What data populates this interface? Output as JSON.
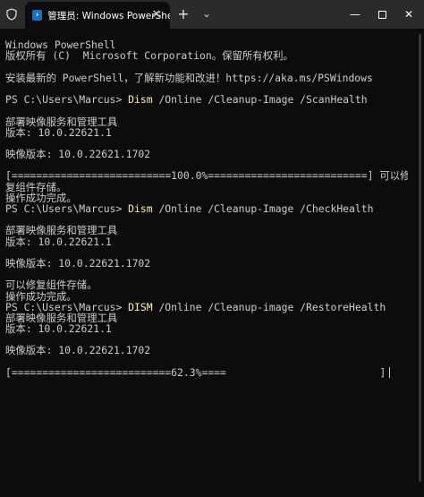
{
  "window": {
    "tab_title": "管理员: Windows PowerShell",
    "tab_close": "✕",
    "new_tab": "+",
    "dropdown": "⌄",
    "minimize": "—",
    "close": "✕"
  },
  "terminal": {
    "l01": "Windows PowerShell",
    "l02": "版权所有 (C)  Microsoft Corporation。保留所有权利。",
    "l03": "",
    "l04": "安装最新的 PowerShell，了解新功能和改进！https://aka.ms/PSWindows",
    "l05": "",
    "p1_prompt": "PS C:\\Users\\Marcus> ",
    "p1_cmd": "Dism",
    "p1_args": " /Online /Cleanup-Image /ScanHealth",
    "l07": "",
    "l08": "部署映像服务和管理工具",
    "l09": "版本: 10.0.22621.1",
    "l10": "",
    "l11": "映像版本: 10.0.22621.1702",
    "l12": "",
    "l13": "[==========================100.0%==========================] 可以修",
    "l14": "复组件存储。",
    "l15": "操作成功完成。",
    "p2_prompt": "PS C:\\Users\\Marcus> ",
    "p2_cmd": "Dism",
    "p2_args": " /Online /Cleanup-Image /CheckHealth",
    "l17": "",
    "l18": "部署映像服务和管理工具",
    "l19": "版本: 10.0.22621.1",
    "l20": "",
    "l21": "映像版本: 10.0.22621.1702",
    "l22": "",
    "l23": "可以修复组件存储。",
    "l24": "操作成功完成。",
    "p3_prompt": "PS C:\\Users\\Marcus> ",
    "p3_cmd": "DISM",
    "p3_args": " /Online /Cleanup-image /RestoreHealth",
    "l26": "部署映像服务和管理工具",
    "l27": "版本: 10.0.22621.1",
    "l28": "",
    "l29": "映像版本: 10.0.22621.1702",
    "l30": "",
    "l31": "[==========================62.3%====                         ]"
  },
  "colors": {
    "background": "#0c0c0c",
    "text": "#cccccc",
    "command": "#f9f1a5",
    "titlebar": "#2b2b2b"
  },
  "icons": {
    "shield": "shield-icon",
    "powershell": "powershell-icon"
  }
}
